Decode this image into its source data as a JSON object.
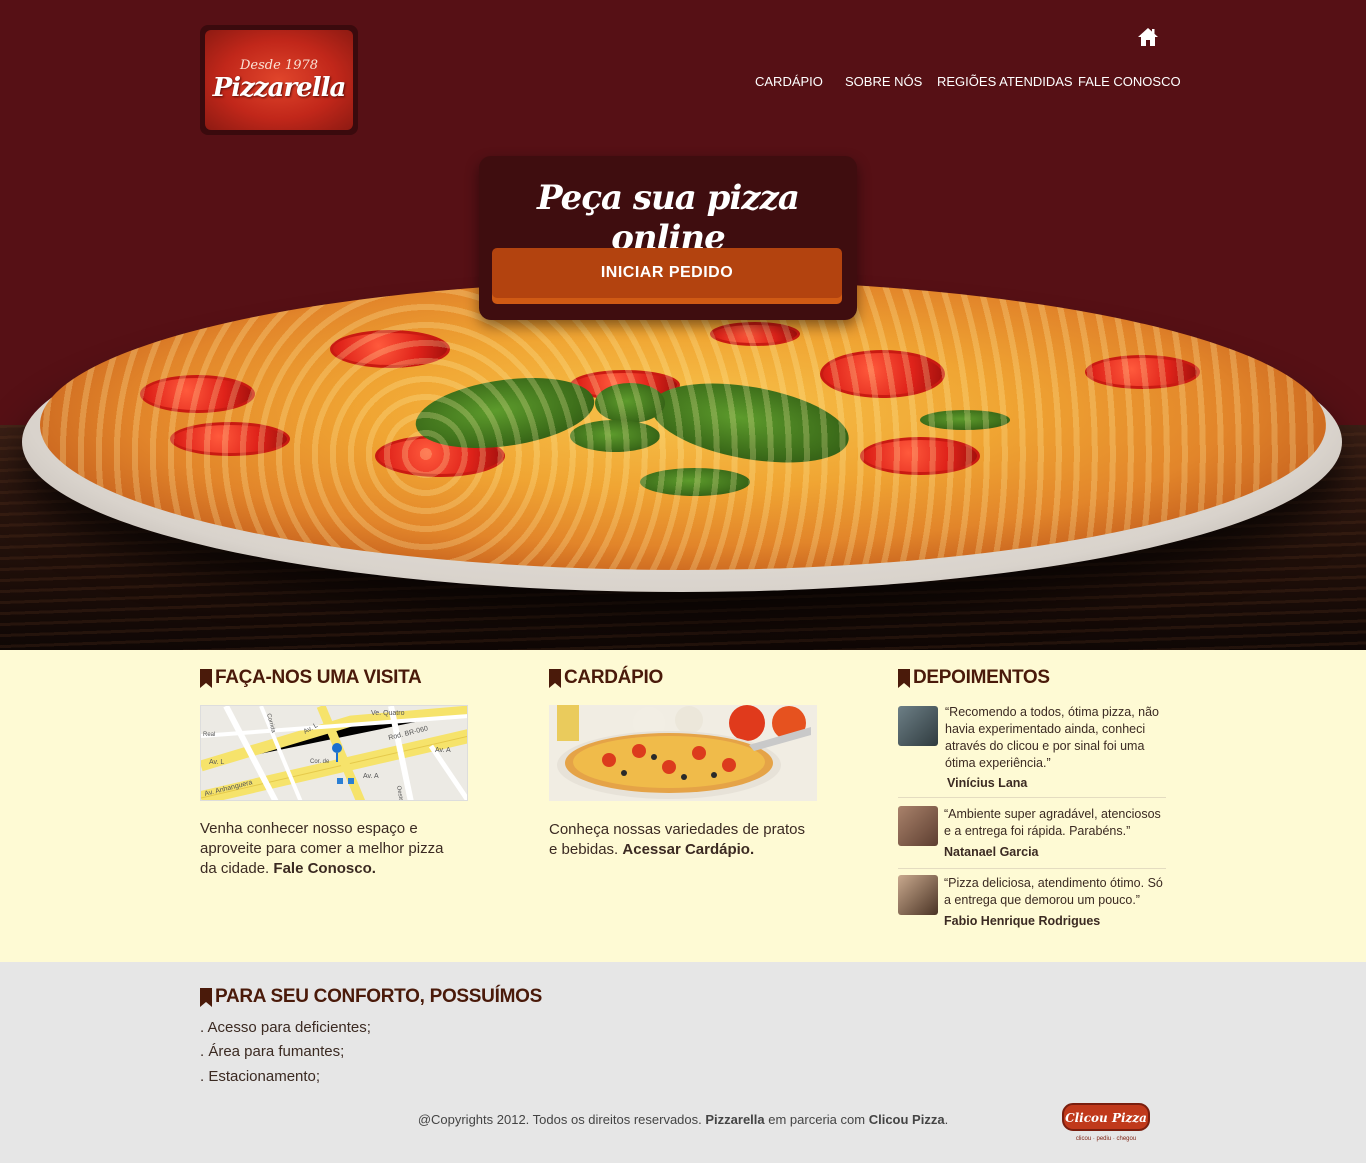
{
  "header": {
    "logo": {
      "since": "Desde 1978",
      "name": "Pizzarella"
    },
    "nav": [
      "CARDÁPIO",
      "SOBRE NÓS",
      "REGIÕES ATENDIDAS",
      "FALE CONOSCO"
    ]
  },
  "hero": {
    "title": "Peça sua pizza online",
    "button": "INICIAR PEDIDO"
  },
  "visit": {
    "title": "FAÇA-NOS UMA VISITA",
    "map_labels": [
      "Av. L",
      "Av. L",
      "Av. Anhanguera",
      "Rod. BR-060",
      "Av. A",
      "Av. A",
      "Ve. Quatro",
      "Cor. de",
      "Oeste",
      "Real",
      "Corrida"
    ],
    "text": "Venha conhecer nosso espaço e aproveite para comer a melhor pizza da cidade.",
    "link": "Fale Conosco."
  },
  "menu": {
    "title": "CARDÁPIO",
    "text": "Conheça nossas variedades de pratos e bebidas.",
    "link": "Acessar Cardápio."
  },
  "testimonials": {
    "title": "DEPOIMENTOS",
    "items": [
      {
        "quote": "“Recomendo a todos, ótima pizza, não havia experimentado ainda, conheci através do clicou e por sinal foi uma ótima experiência.”",
        "name": "Vinícius Lana"
      },
      {
        "quote": "“Ambiente super agradável, atenciosos e a entrega foi rápida. Parabéns.”",
        "name": "Natanael Garcia"
      },
      {
        "quote": "“Pizza deliciosa, atendimento ótimo. Só a entrega que demorou um pouco.”",
        "name": "Fabio Henrique Rodrigues"
      }
    ]
  },
  "comfort": {
    "title": "PARA SEU CONFORTO, POSSUÍMOS",
    "items": [
      ". Acesso para deficientes;",
      ". Área para fumantes;",
      ". Estacionamento;"
    ]
  },
  "footer": {
    "copyright_prefix": "@Copyrights 2012. Todos os direitos reservados.",
    "brand": "Pizzarella",
    "middle": "em parceria com",
    "partner": "Clicou Pizza",
    "suffix": ".",
    "partner_logo_text": "Clicou Pizza",
    "partner_logo_tagline": "clicou · pediu · chegou"
  },
  "colors": {
    "hero_bg": "#561015",
    "accent": "#b3430f",
    "content_bg": "#fefad4",
    "footer_bg": "#e6e6e6",
    "heading": "#4a1a0a"
  }
}
